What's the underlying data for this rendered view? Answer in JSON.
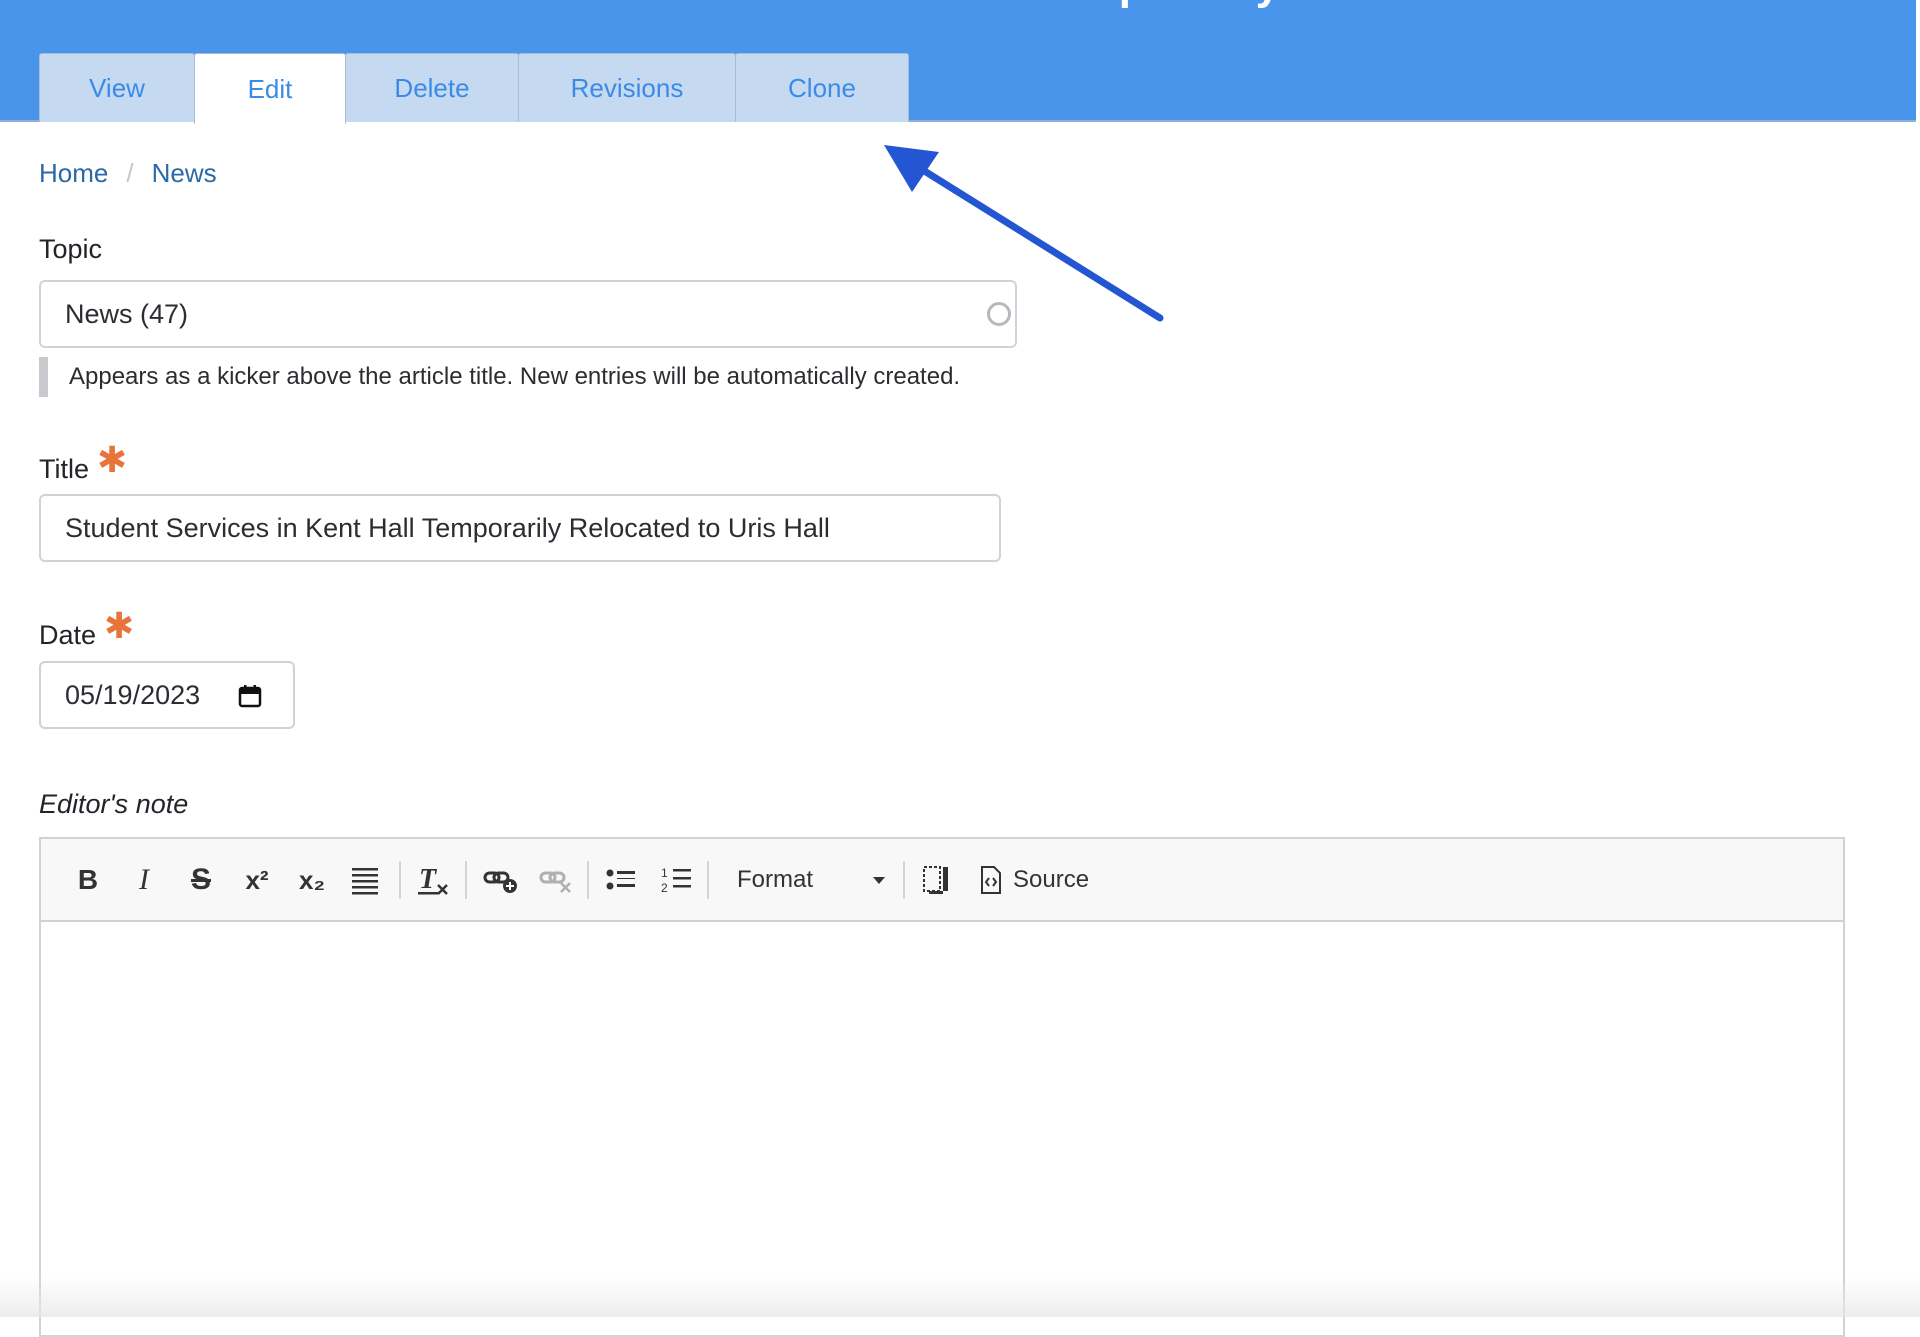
{
  "header": {
    "title": "Edit News Article Student Services in Kent Hall Temporarily Relocated to Uris Hall",
    "tabs": [
      {
        "label": "View",
        "active": false
      },
      {
        "label": "Edit",
        "active": true
      },
      {
        "label": "Delete",
        "active": false
      },
      {
        "label": "Revisions",
        "active": false
      },
      {
        "label": "Clone",
        "active": false
      }
    ],
    "accent_color": "#4a95ec"
  },
  "breadcrumb": {
    "items": [
      "Home",
      "News"
    ],
    "separator": "/"
  },
  "form": {
    "topic": {
      "label": "Topic",
      "value": "News (47)",
      "help": "Appears as a kicker above the article title. New entries will be automatically created."
    },
    "title": {
      "label": "Title",
      "required_mark": "✱",
      "value": "Student Services in Kent Hall Temporarily Relocated to Uris Hall"
    },
    "date": {
      "label": "Date",
      "required_mark": "✱",
      "value": "05/19/2023"
    },
    "editors_note": {
      "label": "Editor's note",
      "toolbar": {
        "bold": "B",
        "italic": "I",
        "strike": "S",
        "superscript": "x²",
        "subscript": "x₂",
        "format_label": "Format",
        "source_label": "Source"
      },
      "content": ""
    }
  },
  "annotation": {
    "arrow_color": "#2456d3",
    "icon": "arrow-pointer"
  }
}
